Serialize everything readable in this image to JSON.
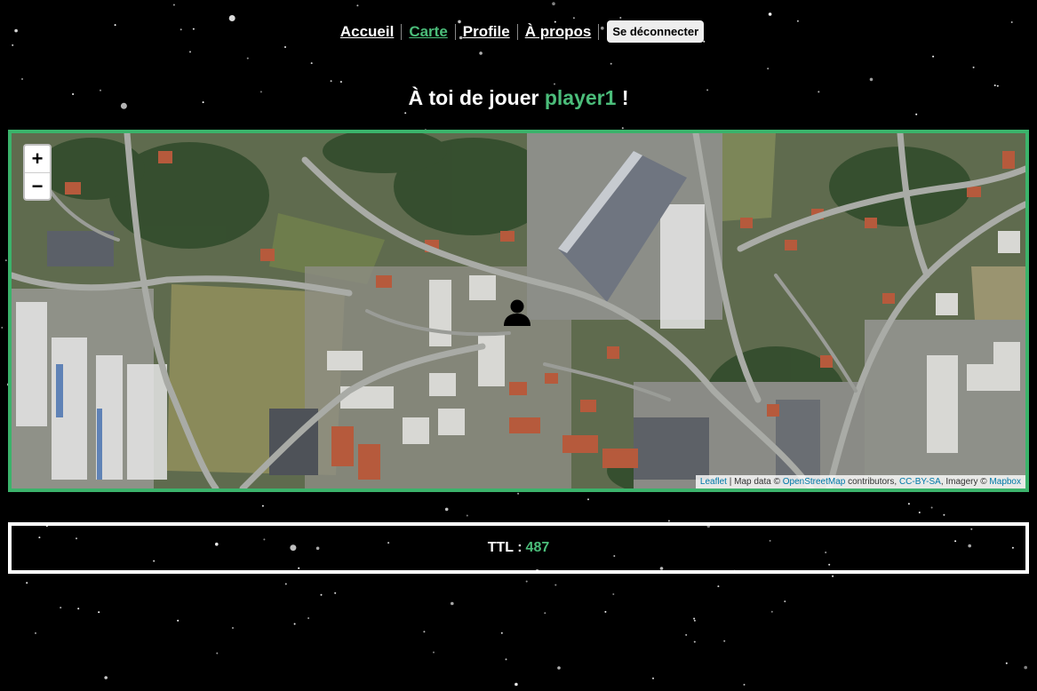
{
  "nav": {
    "items": [
      {
        "label": "Accueil",
        "active": false
      },
      {
        "label": "Carte",
        "active": true
      },
      {
        "label": "Profile",
        "active": false
      },
      {
        "label": "À propos",
        "active": false
      }
    ],
    "logout_label": "Se déconnecter"
  },
  "heading": {
    "prefix": "À toi de jouer",
    "player": "player1",
    "suffix": "!"
  },
  "map": {
    "zoom_in": "+",
    "zoom_out": "−",
    "marker_icon": "user-icon",
    "attribution": {
      "leaflet": "Leaflet",
      "sep": " | Map data © ",
      "osm": "OpenStreetMap",
      "contributors": " contributors, ",
      "license": "CC-BY-SA",
      "imagery": ", Imagery © ",
      "provider": "Mapbox"
    }
  },
  "ttl": {
    "label": "TTL :",
    "value": "487"
  },
  "colors": {
    "accent": "#4bbd7a",
    "map_border": "#3bb36b",
    "background": "#000000"
  }
}
